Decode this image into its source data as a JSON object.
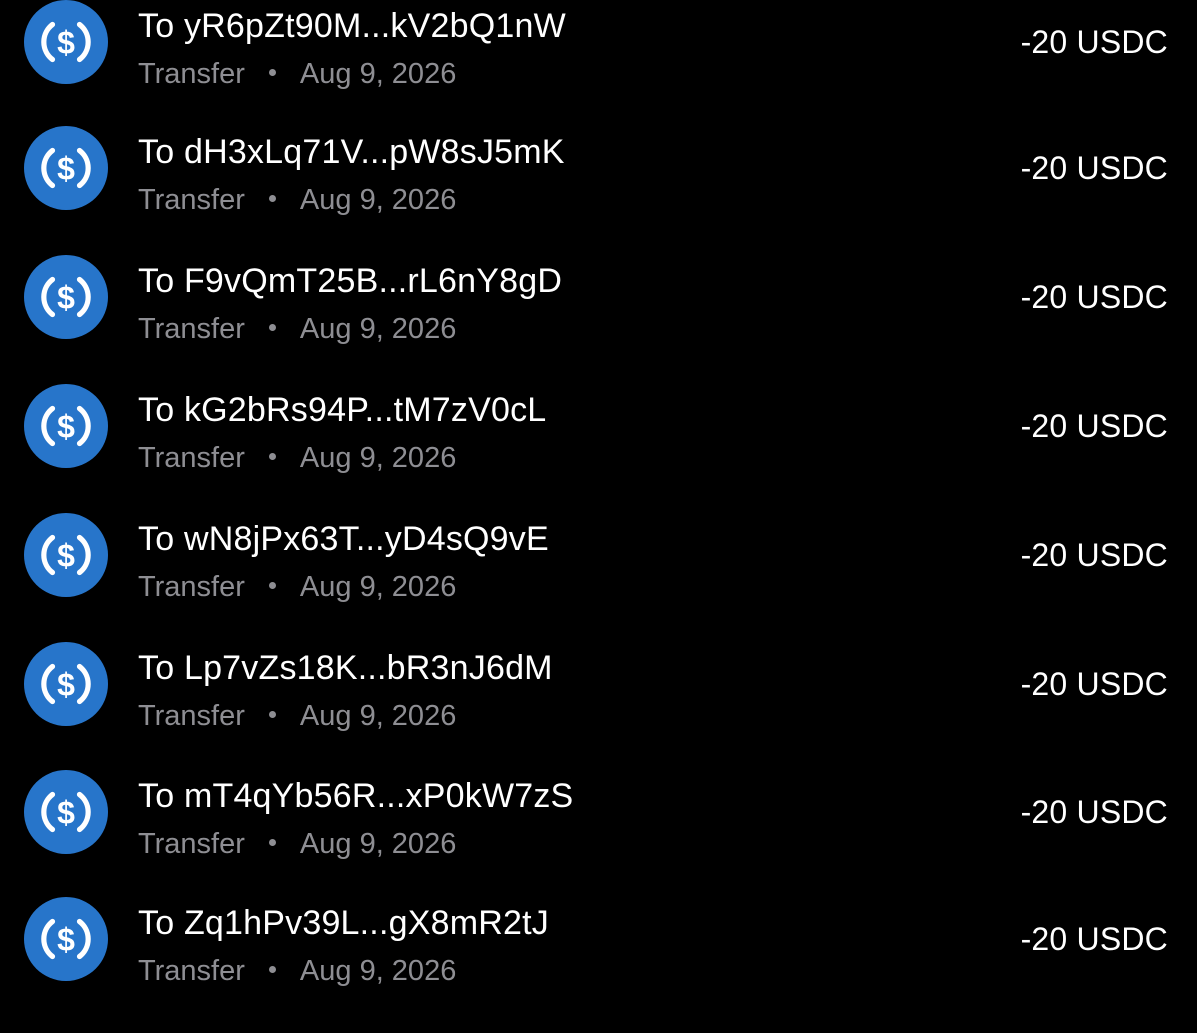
{
  "colors": {
    "background": "#000000",
    "usdc_blue": "#2775ca",
    "primary_text": "#ffffff",
    "secondary_text": "#8e8e93"
  },
  "transactions": [
    {
      "title": "To yR6pZt90M...kV2bQ1nW",
      "type": "Transfer",
      "date": "Aug 9, 2026",
      "amount": "-20 USDC",
      "icon": "usdc-coin-icon"
    },
    {
      "title": "To dH3xLq71V...pW8sJ5mK",
      "type": "Transfer",
      "date": "Aug 9, 2026",
      "amount": "-20 USDC",
      "icon": "usdc-coin-icon"
    },
    {
      "title": "To F9vQmT25B...rL6nY8gD",
      "type": "Transfer",
      "date": "Aug 9, 2026",
      "amount": "-20 USDC",
      "icon": "usdc-coin-icon"
    },
    {
      "title": "To kG2bRs94P...tM7zV0cL",
      "type": "Transfer",
      "date": "Aug 9, 2026",
      "amount": "-20 USDC",
      "icon": "usdc-coin-icon"
    },
    {
      "title": "To wN8jPx63T...yD4sQ9vE",
      "type": "Transfer",
      "date": "Aug 9, 2026",
      "amount": "-20 USDC",
      "icon": "usdc-coin-icon"
    },
    {
      "title": "To Lp7vZs18K...bR3nJ6dM",
      "type": "Transfer",
      "date": "Aug 9, 2026",
      "amount": "-20 USDC",
      "icon": "usdc-coin-icon"
    },
    {
      "title": "To mT4qYb56R...xP0kW7zS",
      "type": "Transfer",
      "date": "Aug 9, 2026",
      "amount": "-20 USDC",
      "icon": "usdc-coin-icon"
    },
    {
      "title": "To Zq1hPv39L...gX8mR2tJ",
      "type": "Transfer",
      "date": "Aug 9, 2026",
      "amount": "-20 USDC",
      "icon": "usdc-coin-icon"
    }
  ]
}
